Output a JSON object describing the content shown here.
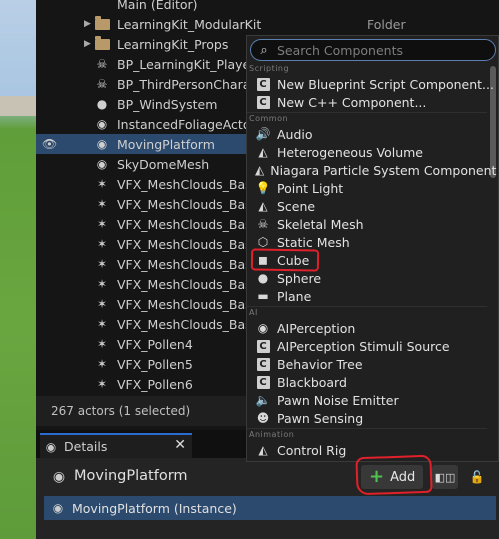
{
  "outliner": {
    "partial_top": "Main (Editor)",
    "rows": [
      {
        "label": "LearningKit_ModularKit",
        "type": "Folder",
        "icon": "folder-icon"
      },
      {
        "label": "LearningKit_Props",
        "type": "",
        "icon": "folder-icon"
      },
      {
        "label": "BP_LearningKit_Player",
        "type": "",
        "icon": "actor-icon"
      },
      {
        "label": "BP_ThirdPersonChara",
        "type": "",
        "icon": "actor-icon"
      },
      {
        "label": "BP_WindSystem",
        "type": "",
        "icon": "actor-icon"
      },
      {
        "label": "InstancedFoliageActor",
        "type": "",
        "icon": "actor-icon"
      },
      {
        "label": "MovingPlatform",
        "type": "",
        "icon": "actor-icon",
        "selected": true
      },
      {
        "label": "SkyDomeMesh",
        "type": "",
        "icon": "actor-icon"
      },
      {
        "label": "VFX_MeshClouds_Bas",
        "type": "",
        "icon": "niagara-icon"
      },
      {
        "label": "VFX_MeshClouds_Bas",
        "type": "",
        "icon": "niagara-icon"
      },
      {
        "label": "VFX_MeshClouds_Bas",
        "type": "",
        "icon": "niagara-icon"
      },
      {
        "label": "VFX_MeshClouds_Bas",
        "type": "",
        "icon": "niagara-icon"
      },
      {
        "label": "VFX_MeshClouds_Bas",
        "type": "",
        "icon": "niagara-icon"
      },
      {
        "label": "VFX_MeshClouds_Bas",
        "type": "",
        "icon": "niagara-icon"
      },
      {
        "label": "VFX_MeshClouds_Bas",
        "type": "",
        "icon": "niagara-icon"
      },
      {
        "label": "VFX_MeshClouds_Bas",
        "type": "",
        "icon": "niagara-icon"
      },
      {
        "label": "VFX_Pollen4",
        "type": "",
        "icon": "niagara-icon"
      },
      {
        "label": "VFX_Pollen5",
        "type": "",
        "icon": "niagara-icon"
      },
      {
        "label": "VFX_Pollen6",
        "type": "",
        "icon": "niagara-icon"
      }
    ],
    "status": "267 actors (1 selected)"
  },
  "details": {
    "tab_label": "Details",
    "actor_name": "MovingPlatform",
    "add_label": "Add",
    "instance_label": "MovingPlatform (Instance)"
  },
  "dropdown": {
    "search_placeholder": "Search Components",
    "categories": {
      "scripting": "Scripting",
      "common": "Common",
      "ai": "AI",
      "animation": "Animation"
    },
    "items": {
      "new_bp_script": "New Blueprint Script Component...",
      "new_cpp": "New C++ Component...",
      "audio": "Audio",
      "hetero_volume": "Heterogeneous Volume",
      "niagara": "Niagara Particle System Component",
      "point_light": "Point Light",
      "scene": "Scene",
      "skeletal_mesh": "Skeletal Mesh",
      "static_mesh": "Static Mesh",
      "cube": "Cube",
      "sphere": "Sphere",
      "plane": "Plane",
      "ai_perception": "AIPerception",
      "ai_stimuli": "AIPerception Stimuli Source",
      "behavior_tree": "Behavior Tree",
      "blackboard": "Blackboard",
      "pawn_noise": "Pawn Noise Emitter",
      "pawn_sensing": "Pawn Sensing",
      "control_rig": "Control Rig"
    }
  },
  "colors": {
    "selection": "#2b4a6e",
    "annotation_red": "#e0202a",
    "add_plus": "#4fc24f"
  }
}
